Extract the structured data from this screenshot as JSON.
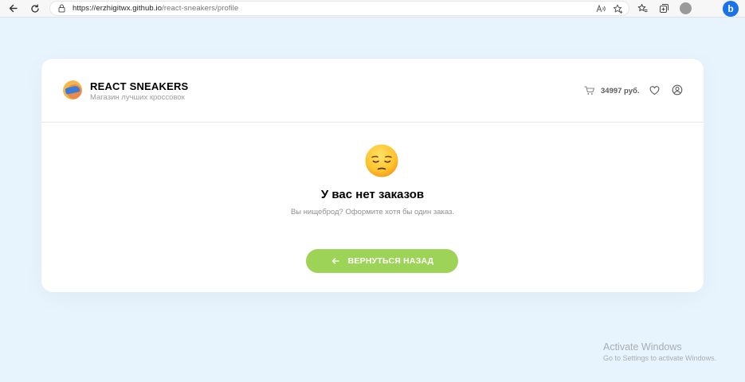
{
  "browser": {
    "url_host": "https://erzhigitwx.github.io",
    "url_path": "/react-sneakers/profile",
    "icons": [
      "back-arrow-icon",
      "refresh-icon",
      "lock-icon",
      "read-aloud-icon",
      "favorite-add-icon",
      "favorites-icon",
      "collections-icon",
      "profile-icon",
      "bing-icon"
    ],
    "bing_glyph": "b"
  },
  "header": {
    "title": "REACT SNEAKERS",
    "subtitle": "Магазин лучших кроссовок",
    "cart_total": "34997 руб."
  },
  "empty_state": {
    "title": "У вас нет заказов",
    "subtitle": "Вы нищеброд? Оформите хотя бы один заказ.",
    "button_label": "ВЕРНУТЬСЯ НАЗАД",
    "emoji": "pensive-face"
  },
  "watermark": {
    "title": "Activate Windows",
    "subtitle": "Go to Settings to activate Windows."
  },
  "colors": {
    "background": "#e7f4fd",
    "accent_green": "#9dd458",
    "text_muted": "#9d9d9d"
  }
}
